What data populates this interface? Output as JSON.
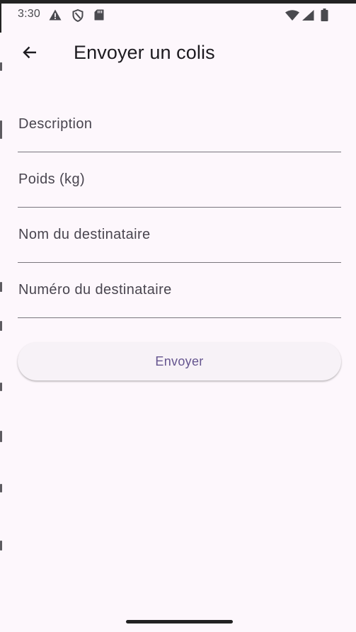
{
  "status_bar": {
    "time": "3:30",
    "left_icons": [
      "warning-icon",
      "shield-icon",
      "sd-card-icon"
    ],
    "right_icons": [
      "wifi-icon",
      "cell-signal-icon",
      "battery-icon"
    ]
  },
  "app_bar": {
    "back_icon": "arrow-back-icon",
    "title": "Envoyer un colis"
  },
  "form": {
    "fields": [
      {
        "label": "Description",
        "value": ""
      },
      {
        "label": "Poids (kg)",
        "value": ""
      },
      {
        "label": "Nom du destinataire",
        "value": ""
      },
      {
        "label": "Numéro du destinataire",
        "value": ""
      }
    ],
    "submit_label": "Envoyer"
  },
  "colors": {
    "background": "#fdf7fc",
    "button_text": "#65558f",
    "underline": "#79767d"
  }
}
